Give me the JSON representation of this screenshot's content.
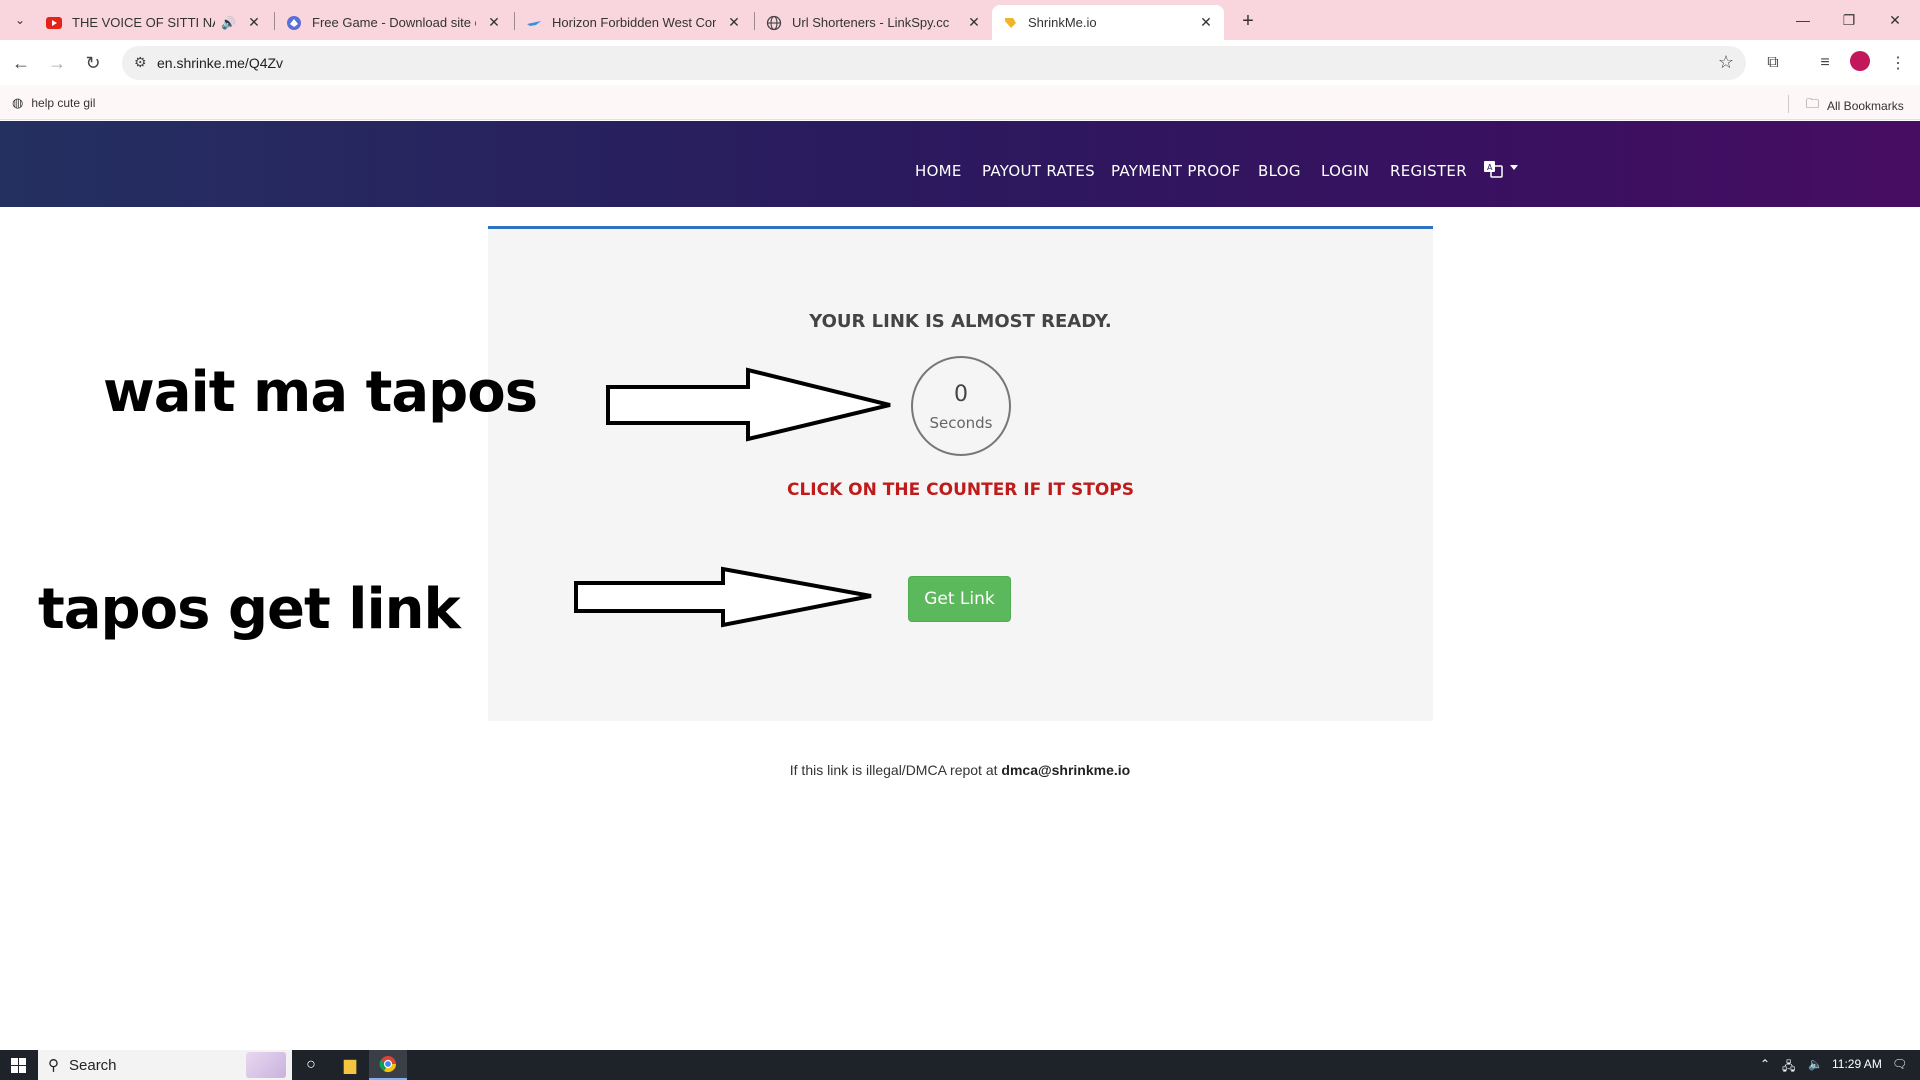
{
  "browser": {
    "tabs": [
      {
        "title": "THE VOICE OF SITTI NAVARR",
        "favicon": "youtube-icon",
        "audio": true
      },
      {
        "title": "Free Game - Download site of p",
        "favicon": "game-site-icon"
      },
      {
        "title": "Horizon Forbidden West Compl",
        "favicon": "plane-icon"
      },
      {
        "title": "Url Shorteners - LinkSpy.cc",
        "favicon": "globe-icon"
      },
      {
        "title": "ShrinkMe.io",
        "favicon": "shrinkme-icon",
        "active": true
      }
    ],
    "url": "en.shrinke.me/Q4Zv",
    "bookmarks": [
      {
        "label": "help cute gil"
      }
    ],
    "all_bookmarks": "All Bookmarks"
  },
  "site": {
    "nav": [
      "HOME",
      "PAYOUT RATES",
      "PAYMENT PROOF",
      "BLOG",
      "LOGIN",
      "REGISTER"
    ],
    "card": {
      "title": "YOUR LINK IS ALMOST READY.",
      "counter_value": "0",
      "counter_unit": "Seconds",
      "warning": "CLICK ON THE COUNTER IF IT STOPS",
      "button": "Get Link"
    },
    "footer": {
      "text": "If this link is illegal/DMCA repot at ",
      "email": "dmca@shrinkme.io"
    }
  },
  "annotations": {
    "wait": "wait ma tapos",
    "get": "tapos get link"
  },
  "taskbar": {
    "search": "Search",
    "time": "11:29 AM"
  },
  "colors": {
    "tabstrip": "#f9d6de",
    "nav_gradient_start": "#243060",
    "nav_gradient_end": "#470d63",
    "card_border": "#2f72c4",
    "warning": "#c01b1b",
    "button": "#5cb85c"
  }
}
